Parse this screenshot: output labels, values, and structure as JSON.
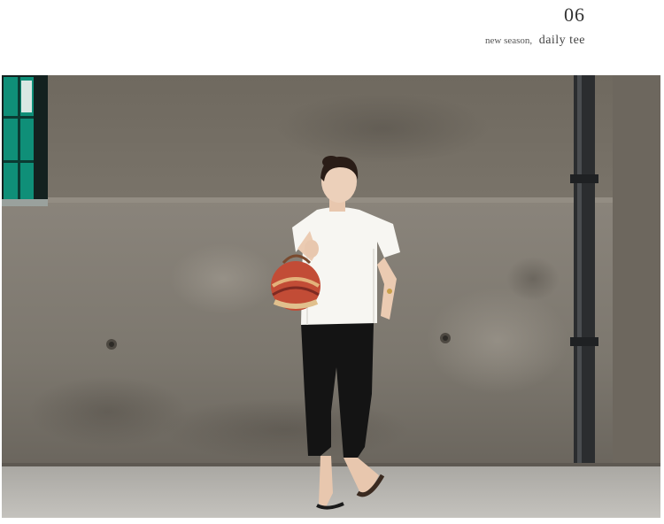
{
  "header": {
    "number": "06",
    "caption_prefix": "new season,",
    "caption_main": "daily tee"
  },
  "photo": {
    "subject": "woman-in-white-tee",
    "colors": {
      "wall": "#7e786f",
      "floor": "#b9b7b2",
      "tee": "#f7f6f2",
      "pants": "#141414",
      "pipe": "#2b2d2f",
      "window": "#0f8f78"
    }
  }
}
